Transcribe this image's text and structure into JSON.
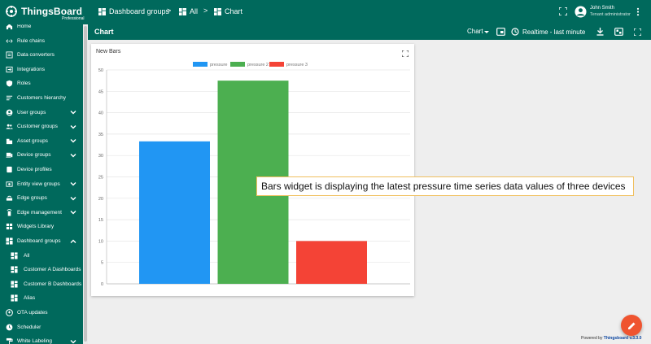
{
  "header": {
    "logo_text": "ThingsBoard",
    "logo_sub": "Professional",
    "breadcrumbs": [
      {
        "label": "Dashboard groups"
      },
      {
        "label": "All"
      },
      {
        "label": "Chart"
      }
    ],
    "separator": ">",
    "user_name": "John Smith",
    "user_role": "Tenant administrator"
  },
  "toolbar": {
    "title": "Chart",
    "state_select": "Chart",
    "timewindow": "Realtime - last minute"
  },
  "sidebar": {
    "items": [
      {
        "label": "Home",
        "icon": "home-icon",
        "expandable": false
      },
      {
        "label": "Rule chains",
        "icon": "rule-chain-icon",
        "expandable": false
      },
      {
        "label": "Data converters",
        "icon": "converter-icon",
        "expandable": false
      },
      {
        "label": "Integrations",
        "icon": "integration-icon",
        "expandable": false
      },
      {
        "label": "Roles",
        "icon": "shield-icon",
        "expandable": false
      },
      {
        "label": "Customers hierarchy",
        "icon": "sort-icon",
        "expandable": false
      },
      {
        "label": "User groups",
        "icon": "account-icon",
        "expandable": true
      },
      {
        "label": "Customer groups",
        "icon": "supervisor-icon",
        "expandable": true
      },
      {
        "label": "Asset groups",
        "icon": "domain-icon",
        "expandable": true
      },
      {
        "label": "Device groups",
        "icon": "devices-icon",
        "expandable": true
      },
      {
        "label": "Device profiles",
        "icon": "device-profile-icon",
        "expandable": false
      },
      {
        "label": "Entity view groups",
        "icon": "entity-view-icon",
        "expandable": true
      },
      {
        "label": "Edge groups",
        "icon": "router-icon",
        "expandable": true
      },
      {
        "label": "Edge management",
        "icon": "settings-remote-icon",
        "expandable": true
      },
      {
        "label": "Widgets Library",
        "icon": "widgets-icon",
        "expandable": false
      },
      {
        "label": "Dashboard groups",
        "icon": "dashboard-icon",
        "expandable": true,
        "expanded": true
      },
      {
        "label": "All",
        "icon": "dashboard-icon",
        "sub": true
      },
      {
        "label": "Customer A Dashboards",
        "icon": "dashboard-icon",
        "sub": true
      },
      {
        "label": "Customer B Dashboards",
        "icon": "dashboard-icon",
        "sub": true
      },
      {
        "label": "Alias",
        "icon": "dashboard-icon",
        "sub": true
      },
      {
        "label": "OTA updates",
        "icon": "memory-icon",
        "expandable": false
      },
      {
        "label": "Scheduler",
        "icon": "schedule-icon",
        "expandable": false
      },
      {
        "label": "White Labeling",
        "icon": "format-paint-icon",
        "expandable": true
      }
    ]
  },
  "widget": {
    "title": "New Bars"
  },
  "chart_data": {
    "type": "bar",
    "categories": [
      ""
    ],
    "series": [
      {
        "name": "pressure",
        "values": [
          33.3
        ],
        "color": "#2196f3"
      },
      {
        "name": "pressure 2",
        "values": [
          47.5
        ],
        "color": "#4caf50"
      },
      {
        "name": "pressure 3",
        "values": [
          10
        ],
        "color": "#f44336"
      }
    ],
    "yticks": [
      0,
      5,
      10,
      15,
      20,
      25,
      30,
      35,
      40,
      45,
      50
    ],
    "ylim": [
      0,
      50
    ],
    "grid": true,
    "legend": "top"
  },
  "banner": {
    "text": "Bars widget is displaying the latest pressure time series data values of three devices"
  },
  "footer": {
    "prefix": "Powered by",
    "link": "Thingsboard v.3.3.0"
  },
  "colors": {
    "primary": "#00695c",
    "accent": "#ef5430"
  }
}
